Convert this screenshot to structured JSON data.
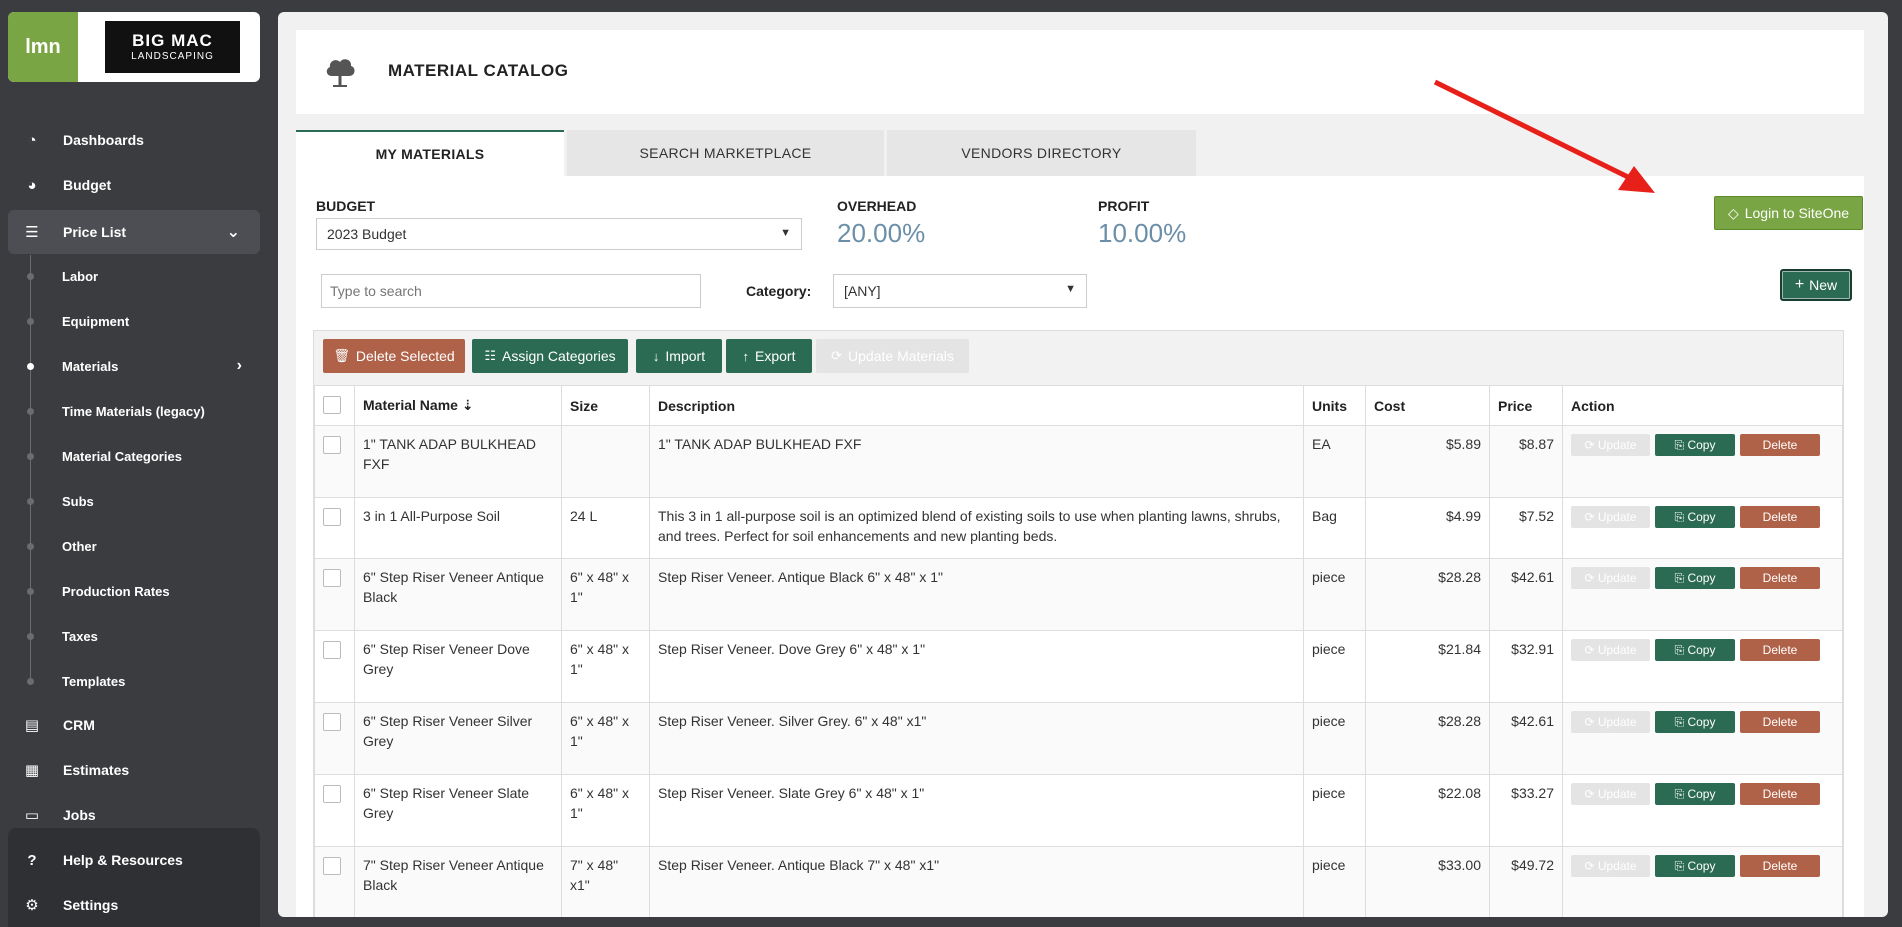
{
  "sidebar": {
    "brand_lmn": "lmn",
    "brand_big": "BIG MAC",
    "brand_sub": "LANDSCAPING",
    "items": [
      {
        "label": "Dashboards",
        "icon": "gauge-icon"
      },
      {
        "label": "Budget",
        "icon": "pie-icon"
      },
      {
        "label": "Price List",
        "icon": "list-icon"
      },
      {
        "label": "CRM",
        "icon": "contacts-icon"
      },
      {
        "label": "Estimates",
        "icon": "calculator-icon"
      },
      {
        "label": "Jobs",
        "icon": "jobs-icon"
      }
    ],
    "sub_items": [
      "Labor",
      "Equipment",
      "Materials",
      "Time Materials (legacy)",
      "Material Categories",
      "Subs",
      "Other",
      "Production Rates",
      "Taxes",
      "Templates"
    ],
    "bottom": [
      {
        "label": "Help & Resources",
        "icon": "help-icon"
      },
      {
        "label": "Settings",
        "icon": "gear-icon"
      }
    ]
  },
  "header": {
    "title": "MATERIAL CATALOG"
  },
  "tabs": [
    "MY MATERIALS",
    "SEARCH MARKETPLACE",
    "VENDORS DIRECTORY"
  ],
  "budget": {
    "label": "BUDGET",
    "value": "2023 Budget"
  },
  "overhead": {
    "label": "OVERHEAD",
    "value": "20.00%"
  },
  "profit": {
    "label": "PROFIT",
    "value": "10.00%"
  },
  "buttons": {
    "siteone": "Login to SiteOne",
    "new": "New"
  },
  "search": {
    "placeholder": "Type to search"
  },
  "category": {
    "label": "Category:",
    "value": "[ANY]"
  },
  "toolbar": {
    "delete": "Delete Selected",
    "assign": "Assign Categories",
    "import": "Import",
    "export": "Export",
    "update": "Update Materials"
  },
  "table": {
    "headers": [
      "Material Name",
      "Size",
      "Description",
      "Units",
      "Cost",
      "Price",
      "Action"
    ],
    "action_labels": {
      "update": "Update",
      "copy": "Copy",
      "delete": "Delete"
    },
    "rows": [
      {
        "name": "1\" TANK ADAP BULKHEAD FXF",
        "size": "",
        "desc": "1\" TANK ADAP BULKHEAD FXF",
        "units": "EA",
        "cost": "$5.89",
        "price": "$8.87"
      },
      {
        "name": "3 in 1 All-Purpose Soil",
        "size": "24 L",
        "desc": "This 3 in 1 all-purpose soil is an optimized blend of existing soils to use when planting lawns, shrubs, and trees. Perfect for soil enhancements and new planting beds.",
        "units": "Bag",
        "cost": "$4.99",
        "price": "$7.52"
      },
      {
        "name": "6\" Step Riser Veneer Antique Black",
        "size": "6\" x 48\" x 1\"",
        "desc": "Step Riser Veneer. Antique Black 6\" x 48\" x 1\"",
        "units": "piece",
        "cost": "$28.28",
        "price": "$42.61"
      },
      {
        "name": "6\" Step Riser Veneer Dove Grey",
        "size": "6\" x 48\" x 1\"",
        "desc": "Step Riser Veneer. Dove Grey 6\" x 48\" x 1\"",
        "units": "piece",
        "cost": "$21.84",
        "price": "$32.91"
      },
      {
        "name": "6\" Step Riser Veneer Silver Grey",
        "size": "6\" x 48\" x 1\"",
        "desc": "Step Riser Veneer. Silver Grey. 6\" x 48\" x1\"",
        "units": "piece",
        "cost": "$28.28",
        "price": "$42.61"
      },
      {
        "name": "6\" Step Riser Veneer Slate Grey",
        "size": "6\" x 48\" x 1\"",
        "desc": "Step Riser Veneer. Slate Grey 6\" x 48\" x 1\"",
        "units": "piece",
        "cost": "$22.08",
        "price": "$33.27"
      },
      {
        "name": "7\" Step Riser Veneer Antique Black",
        "size": "7\" x 48\" x1\"",
        "desc": "Step Riser Veneer. Antique Black 7\" x 48\" x1\"",
        "units": "piece",
        "cost": "$33.00",
        "price": "$49.72"
      }
    ]
  },
  "colors": {
    "accent_green": "#7aa544",
    "dark_green": "#2b6b54",
    "delete_red": "#b06248",
    "annotation_arrow": "#e8201a"
  }
}
